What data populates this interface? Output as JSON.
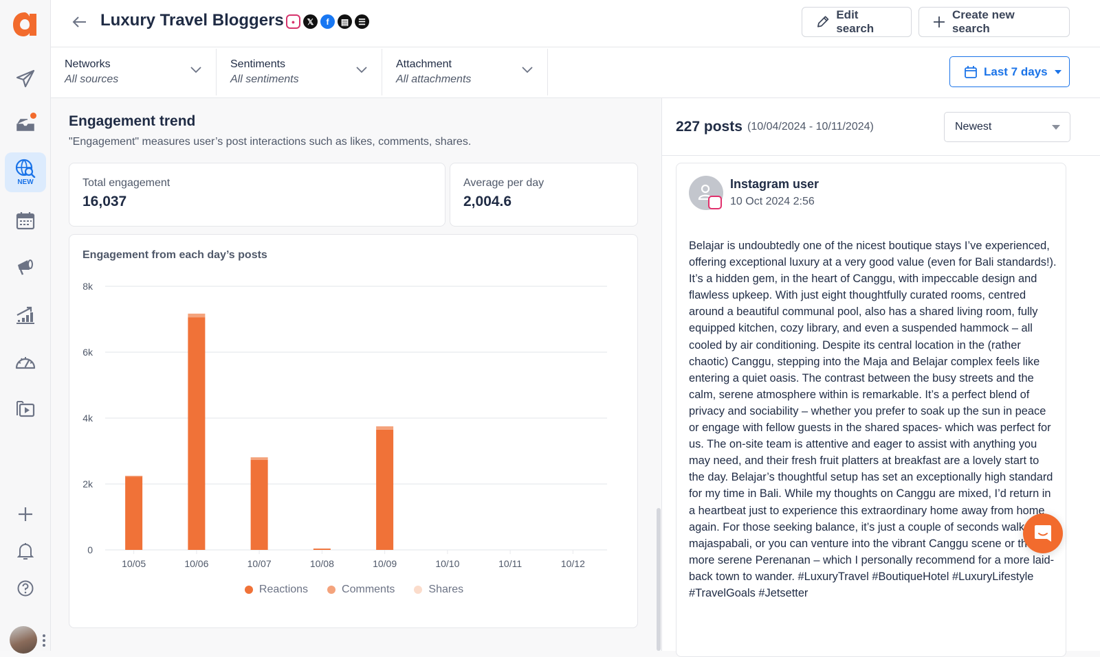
{
  "app": {
    "logo_letter": "a",
    "brand_color": "#f26b2d",
    "accent_color": "#1a73e8"
  },
  "sidebar": {
    "items": [
      {
        "name": "publish",
        "icon": "paper-plane-icon"
      },
      {
        "name": "inbox",
        "icon": "inbox-tray-icon",
        "has_badge": true
      },
      {
        "name": "listening",
        "icon": "globe-search-icon",
        "label": "NEW",
        "active": true
      },
      {
        "name": "calendar",
        "icon": "calendar-icon"
      },
      {
        "name": "campaigns",
        "icon": "megaphone-icon"
      },
      {
        "name": "analytics",
        "icon": "bar-chart-trend-icon"
      },
      {
        "name": "dashboard",
        "icon": "speedometer-icon"
      },
      {
        "name": "media-library",
        "icon": "media-folder-icon"
      }
    ],
    "bottom": [
      {
        "name": "add",
        "icon": "plus-icon"
      },
      {
        "name": "notifications",
        "icon": "bell-icon"
      },
      {
        "name": "help",
        "icon": "question-circle-icon"
      }
    ]
  },
  "header": {
    "title": "Luxury Travel Bloggers",
    "networks": [
      "instagram",
      "x",
      "facebook",
      "reviews",
      "news"
    ],
    "edit_label": "Edit search",
    "create_label": "Create new search"
  },
  "filters": [
    {
      "label": "Networks",
      "value": "All sources"
    },
    {
      "label": "Sentiments",
      "value": "All sentiments"
    },
    {
      "label": "Attachment",
      "value": "All attachments"
    }
  ],
  "date_range": {
    "label": "Last 7 days"
  },
  "engagement": {
    "title": "Engagement trend",
    "subtitle": "\"Engagement\" measures user’s post interactions such as likes, comments, shares.",
    "total_label": "Total engagement",
    "total_value": "16,037",
    "avg_label": "Average per day",
    "avg_value": "2,004.6"
  },
  "chart_data": {
    "type": "bar",
    "stacked": true,
    "title": "Engagement from each day’s posts",
    "xlabel": "",
    "ylabel": "",
    "categories": [
      "10/05",
      "10/06",
      "10/07",
      "10/08",
      "10/09",
      "10/10",
      "10/11",
      "10/12"
    ],
    "series": [
      {
        "name": "Reactions",
        "color": "#f07238",
        "values": [
          2240,
          7060,
          2730,
          40,
          3650,
          0,
          0,
          0
        ]
      },
      {
        "name": "Comments",
        "color": "#f4a37c",
        "values": [
          10,
          110,
          80,
          0,
          100,
          0,
          0,
          0
        ]
      },
      {
        "name": "Shares",
        "color": "#fbdccb",
        "values": [
          0,
          0,
          0,
          0,
          0,
          0,
          0,
          0
        ]
      }
    ],
    "ylim": [
      0,
      8000
    ],
    "yticks": [
      0,
      2000,
      4000,
      6000,
      8000
    ],
    "ytick_labels": [
      "0",
      "2k",
      "4k",
      "6k",
      "8k"
    ],
    "grid": true,
    "legend_position": "bottom-center"
  },
  "posts": {
    "count_label": "227 posts",
    "range_label": "(10/04/2024 - 10/11/2024)",
    "sort_value": "Newest",
    "items": [
      {
        "author": "Instagram user",
        "network": "instagram",
        "date": "10 Oct 2024 2:56",
        "text": "Belajar is undoubtedly one of the nicest boutique stays I’ve experienced, offering exceptional luxury at a very good value (even for Bali standards!). It’s a hidden gem, in the heart of Canggu, with impeccable design and flawless upkeep. With just eight thoughtfully curated rooms, centred around a beautiful communal pool, also has a shared living room, fully equipped kitchen, cozy library, and even a suspended hammock – all cooled by air conditioning. Despite its central location in the (rather chaotic) Canggu, stepping into the Maja and Belajar complex feels like entering a quiet oasis. The contrast between the busy streets and the calm, serene atmosphere within is remarkable. It’s a perfect blend of privacy and sociability – whether you prefer to soak up the sun in peace or engage with fellow guests in the shared spaces- which was perfect for us. The on-site team is attentive and eager to assist with anything you may need, and their fresh fruit platters at breakfast are a lovely start to the day. Belajar’s thoughtful setup has set an exceptionally high standard for my time in Bali. While my thoughts on Canggu are mixed, I’d return in a heartbeat just to experience this extraordinary home away from home again. For those seeking balance, it’s just a couple of seconds walk to majaspabali, or you can venture into the vibrant Canggu scene or the more serene Perenanan – which I personally recommend for a more laid-back town to wander. #LuxuryTravel #BoutiqueHotel #LuxuryLifestyle #TravelGoals #Jetsetter"
      }
    ]
  }
}
